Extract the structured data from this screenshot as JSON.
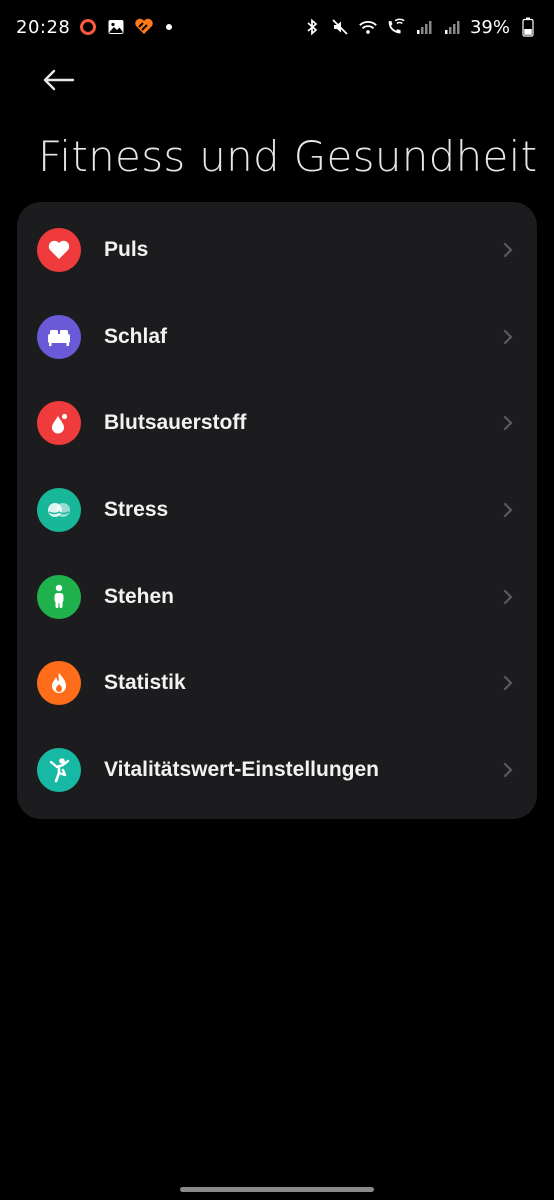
{
  "status_bar": {
    "time": "20:28",
    "battery": "39%",
    "left_icons": [
      "record-circle-icon",
      "gallery-icon",
      "app-badge-icon",
      "notification-dot"
    ],
    "right_icons": [
      "bluetooth-icon",
      "mute-icon",
      "wifi-icon",
      "wifi-calling-icon",
      "signal-icon",
      "signal-icon-2",
      "battery-icon"
    ]
  },
  "header": {
    "back_icon": "arrow-left-icon",
    "title": "Fitness und Gesundheit"
  },
  "menu": {
    "items": [
      {
        "label": "Puls",
        "icon": "heart-icon",
        "color": "#ef3b3b"
      },
      {
        "label": "Schlaf",
        "icon": "bed-icon",
        "color": "#6a5ad8"
      },
      {
        "label": "Blutsauerstoff",
        "icon": "blood-drop-icon",
        "color": "#ef3b3b"
      },
      {
        "label": "Stress",
        "icon": "stress-icon",
        "color": "#19b79a"
      },
      {
        "label": "Stehen",
        "icon": "standing-person-icon",
        "color": "#1fb24c"
      },
      {
        "label": "Statistik",
        "icon": "flame-icon",
        "color": "#ff6d1a"
      },
      {
        "label": "Vitalitätswert-Einstellungen",
        "icon": "activity-person-icon",
        "color": "#17b9a5"
      }
    ]
  },
  "colors": {
    "background": "#000000",
    "card": "#1c1c1e",
    "chevron": "#5a5a5e"
  }
}
